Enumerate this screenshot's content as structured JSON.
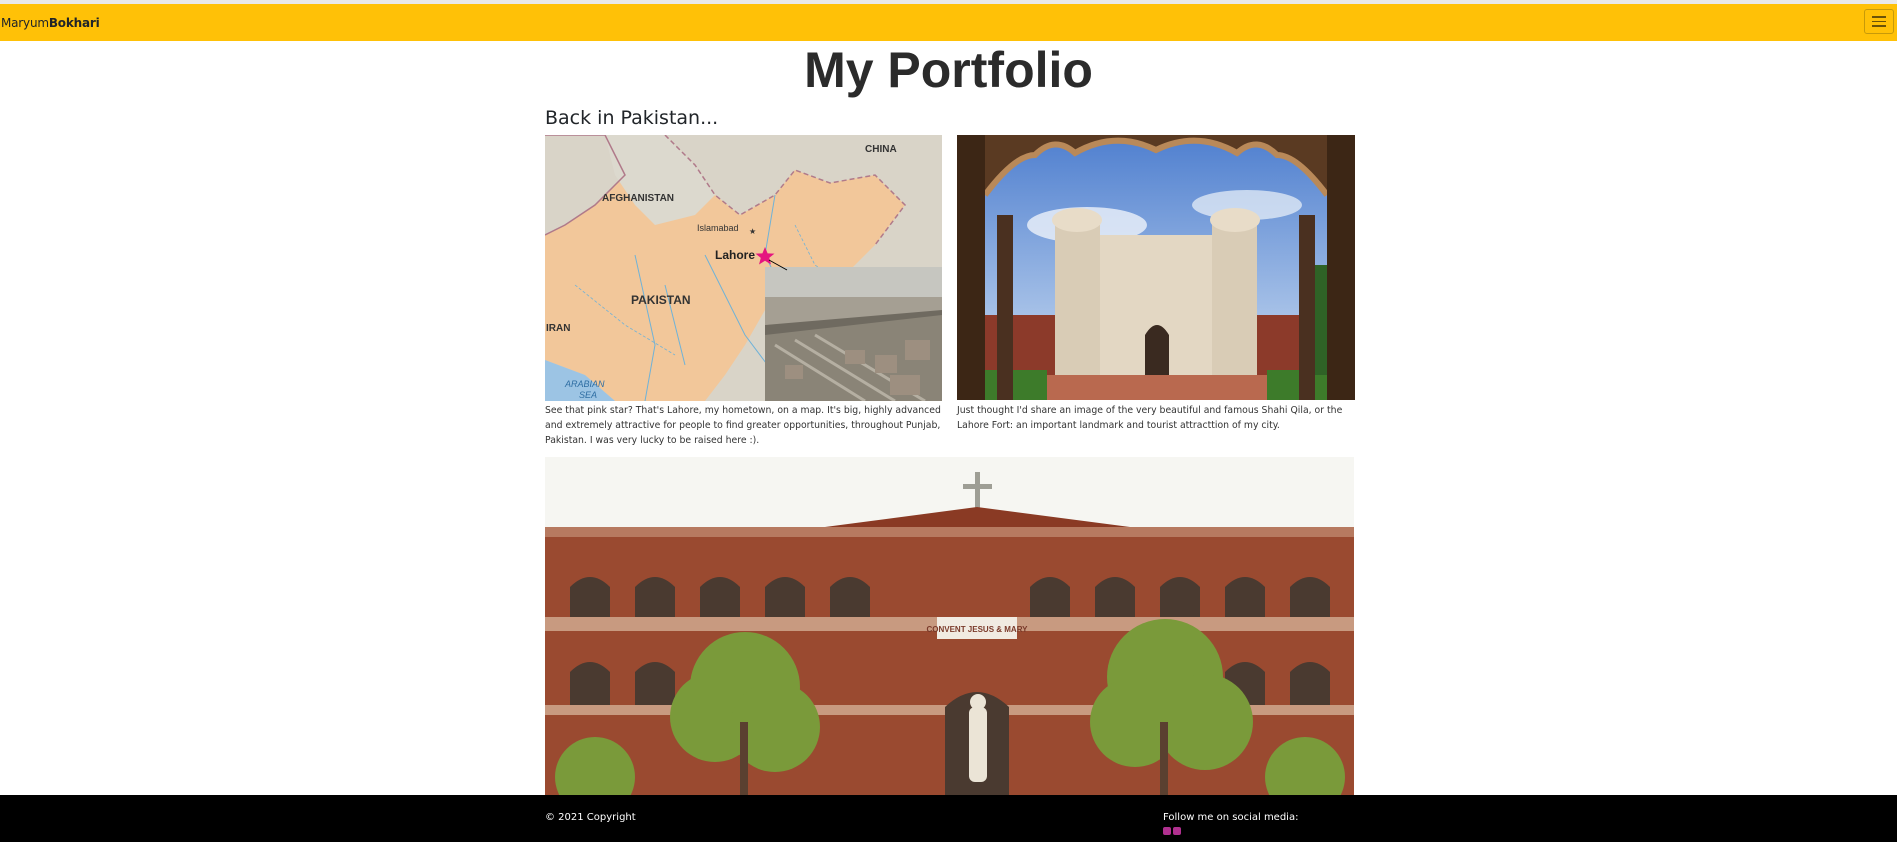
{
  "navbar": {
    "brand_first": "Maryum",
    "brand_last": "Bokhari"
  },
  "page": {
    "title": "My Portfolio",
    "subtitle": "Back in Pakistan..."
  },
  "gallery": {
    "map": {
      "labels": {
        "china": "CHINA",
        "afghanistan": "AFGHANISTAN",
        "islamabad": "Islamabad",
        "lahore": "Lahore",
        "pakistan": "PAKISTAN",
        "iran": "IRAN",
        "arabian": "ARABIAN",
        "sea": "SEA"
      },
      "caption": "See that pink star? That's Lahore, my hometown, on a map. It's big, highly advanced and extremely attractive for people to find greater opportunities, throughout Punjab, Pakistan. I was very lucky to be raised here :)."
    },
    "fort": {
      "caption": "Just thought I'd share an image of the very beautiful and famous Shahi Qila, or the Lahore Fort: an important landmark and tourist attracttion of my city."
    },
    "convent": {
      "sign": "CONVENT JESUS & MARY"
    }
  },
  "footer": {
    "copyright": "© 2021 Copyright",
    "follow": "Follow me on social media:",
    "social": [
      "linkedin-icon",
      "instagram-icon"
    ]
  },
  "colors": {
    "navbar": "#ffc107",
    "footer": "#000000",
    "lahore_star": "#e5157f"
  }
}
